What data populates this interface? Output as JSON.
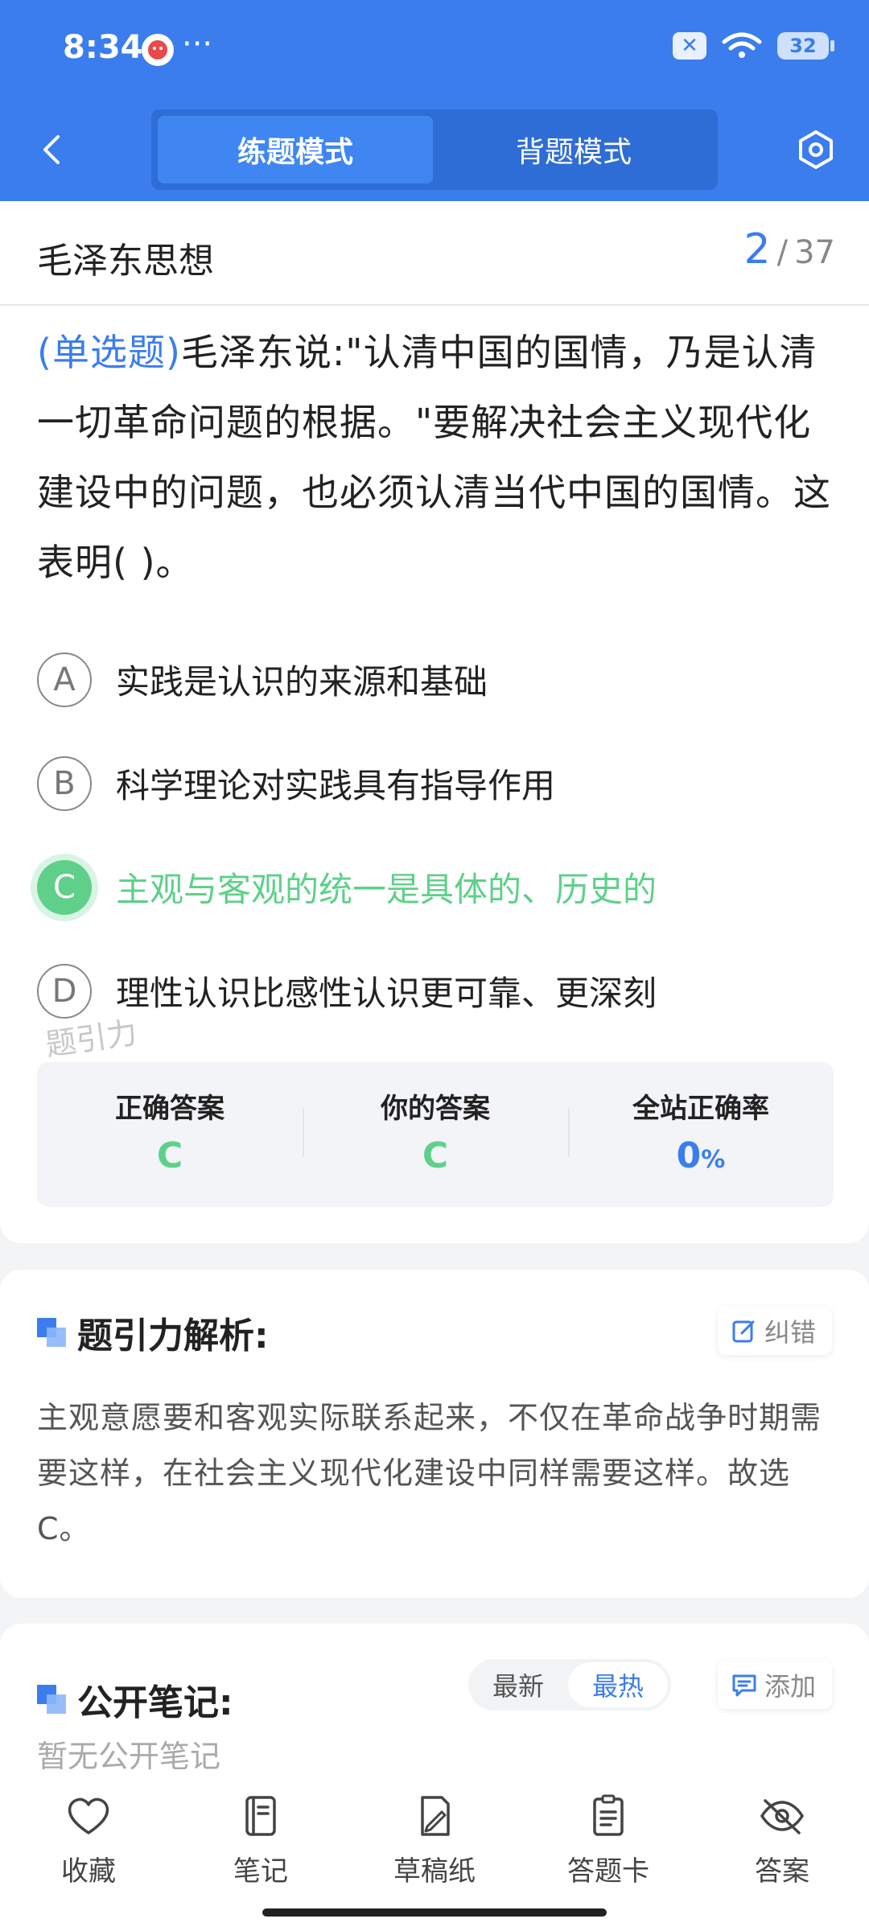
{
  "status_bar": {
    "time": "8:34",
    "dots": "···",
    "battery": "32"
  },
  "header": {
    "tabs": [
      {
        "label": "练题模式"
      },
      {
        "label": "背题模式"
      }
    ]
  },
  "question_card": {
    "subject": "毛泽东思想",
    "progress_current": "2",
    "progress_separator": "/",
    "progress_total": "37",
    "question_type": "(单选题)",
    "question_text": "毛泽东说:\"认清中国的国情，乃是认清一切革命问题的根据。\"要解决社会主义现代化建设中的问题，也必须认清当代中国的国情。这表明(        )。",
    "options": [
      {
        "letter": "A",
        "text": "实践是认识的来源和基础"
      },
      {
        "letter": "B",
        "text": "科学理论对实践具有指导作用"
      },
      {
        "letter": "C",
        "text": "主观与客观的统一是具体的、历史的"
      },
      {
        "letter": "D",
        "text": "理性认识比感性认识更可靠、更深刻"
      }
    ],
    "watermark": "题引力",
    "answer_panel": {
      "correct_label": "正确答案",
      "correct_value": "C",
      "your_label": "你的答案",
      "your_value": "C",
      "rate_label": "全站正确率",
      "rate_value": "0",
      "rate_unit": "%"
    }
  },
  "analysis": {
    "title": "题引力解析:",
    "correction_label": "纠错",
    "text": "主观意愿要和客观实际联系起来，不仅在革命战争时期需要这样，在社会主义现代化建设中同样需要这样。故选C。"
  },
  "notes": {
    "title": "公开笔记:",
    "sort_latest": "最新",
    "sort_hot": "最热",
    "add_label": "添加",
    "empty_text": "暂无公开笔记"
  },
  "bottom_nav": {
    "items": [
      {
        "label": "收藏",
        "icon": "heart-icon"
      },
      {
        "label": "笔记",
        "icon": "notebook-icon"
      },
      {
        "label": "草稿纸",
        "icon": "draft-paper-icon"
      },
      {
        "label": "答题卡",
        "icon": "answer-sheet-icon"
      },
      {
        "label": "答案",
        "icon": "eye-off-icon"
      }
    ]
  },
  "colors": {
    "primary": "#3b7ded",
    "correct": "#5fd08a"
  }
}
